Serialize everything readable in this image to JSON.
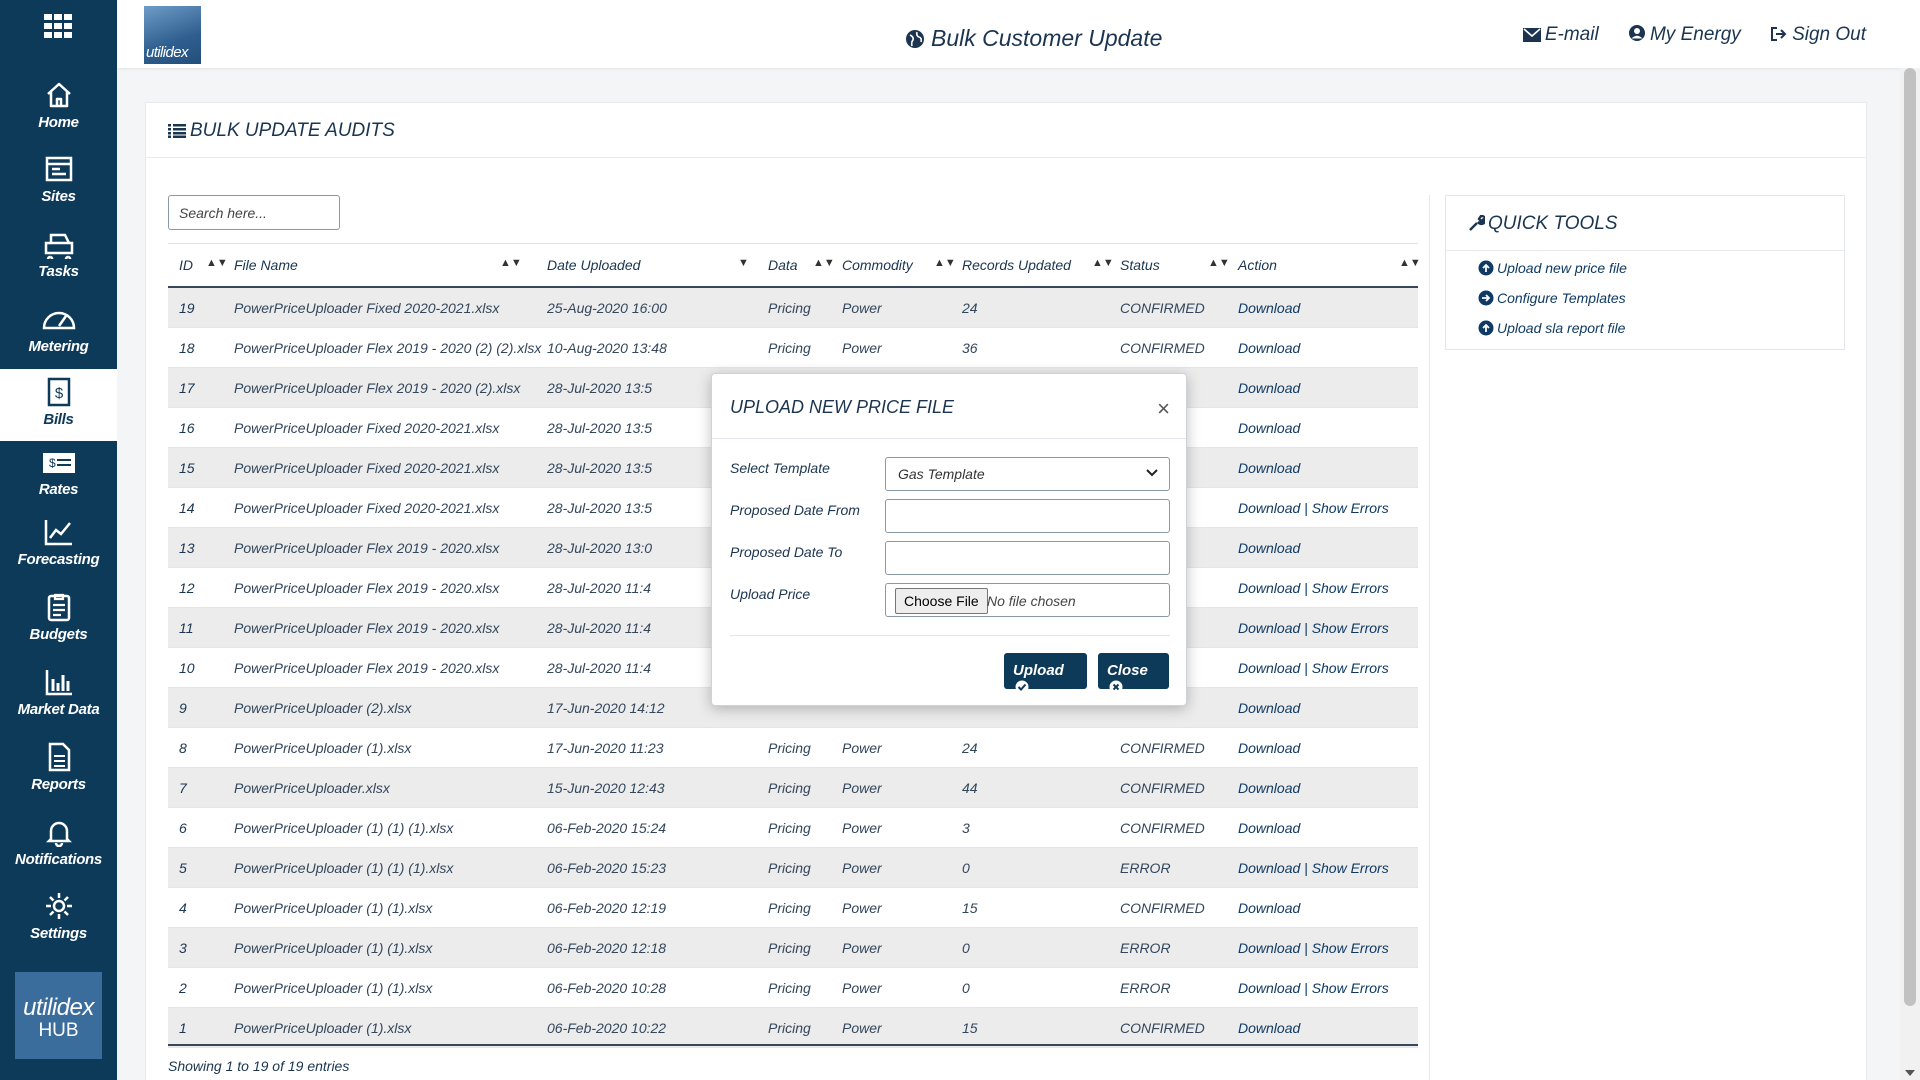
{
  "app": {
    "logo_text": "utilidex",
    "title": "Bulk Customer Update",
    "links": {
      "email": "E-mail",
      "energy": "My Energy",
      "signout": "Sign Out"
    }
  },
  "sidebar": {
    "items": [
      {
        "label": "Home",
        "icon": "home-icon"
      },
      {
        "label": "Sites",
        "icon": "sites-icon"
      },
      {
        "label": "Tasks",
        "icon": "tasks-icon"
      },
      {
        "label": "Metering",
        "icon": "gauge-icon"
      },
      {
        "label": "Bills",
        "icon": "bill-icon",
        "active": true
      },
      {
        "label": "Rates",
        "icon": "rates-icon"
      },
      {
        "label": "Forecasting",
        "icon": "chart-line-icon"
      },
      {
        "label": "Budgets",
        "icon": "clipboard-icon"
      },
      {
        "label": "Market Data",
        "icon": "bar-chart-icon"
      },
      {
        "label": "Reports",
        "icon": "document-icon"
      },
      {
        "label": "Notifications",
        "icon": "bell-icon"
      },
      {
        "label": "Settings",
        "icon": "gear-icon"
      }
    ],
    "hub": {
      "line1": "utilidex",
      "line2": "HUB"
    }
  },
  "audits": {
    "title": "BULK UPDATE AUDITS",
    "search_placeholder": "Search here...",
    "columns": [
      "ID",
      "File Name",
      "Date Uploaded",
      "Data",
      "Commodity",
      "Records Updated",
      "Status",
      "Action"
    ],
    "rows": [
      {
        "id": "19",
        "file": "PowerPriceUploader Fixed 2020-2021.xlsx",
        "date": "25-Aug-2020 16:00",
        "data": "Pricing",
        "commodity": "Power",
        "records": "24",
        "status": "CONFIRMED",
        "show_errors": false
      },
      {
        "id": "18",
        "file": "PowerPriceUploader Flex 2019 - 2020 (2) (2).xlsx",
        "date": "10-Aug-2020 13:48",
        "data": "Pricing",
        "commodity": "Power",
        "records": "36",
        "status": "CONFIRMED",
        "show_errors": false
      },
      {
        "id": "17",
        "file": "PowerPriceUploader Flex 2019 - 2020 (2).xlsx",
        "date": "28-Jul-2020 13:5",
        "data": "",
        "commodity": "",
        "records": "",
        "status": "ED",
        "show_errors": false
      },
      {
        "id": "16",
        "file": "PowerPriceUploader Fixed 2020-2021.xlsx",
        "date": "28-Jul-2020 13:5",
        "data": "",
        "commodity": "",
        "records": "",
        "status": "ED",
        "show_errors": false
      },
      {
        "id": "15",
        "file": "PowerPriceUploader Fixed 2020-2021.xlsx",
        "date": "28-Jul-2020 13:5",
        "data": "",
        "commodity": "",
        "records": "",
        "status": "D",
        "show_errors": false
      },
      {
        "id": "14",
        "file": "PowerPriceUploader Fixed 2020-2021.xlsx",
        "date": "28-Jul-2020 13:5",
        "data": "",
        "commodity": "",
        "records": "",
        "status": "",
        "show_errors": true
      },
      {
        "id": "13",
        "file": "PowerPriceUploader Flex 2019 - 2020.xlsx",
        "date": "28-Jul-2020 13:0",
        "data": "",
        "commodity": "",
        "records": "",
        "status": "ED",
        "show_errors": false
      },
      {
        "id": "12",
        "file": "PowerPriceUploader Flex 2019 - 2020.xlsx",
        "date": "28-Jul-2020 11:4",
        "data": "",
        "commodity": "",
        "records": "",
        "status": "",
        "show_errors": true
      },
      {
        "id": "11",
        "file": "PowerPriceUploader Flex 2019 - 2020.xlsx",
        "date": "28-Jul-2020 11:4",
        "data": "",
        "commodity": "",
        "records": "",
        "status": "",
        "show_errors": true
      },
      {
        "id": "10",
        "file": "PowerPriceUploader Flex 2019 - 2020.xlsx",
        "date": "28-Jul-2020 11:4",
        "data": "",
        "commodity": "",
        "records": "",
        "status": "",
        "show_errors": true
      },
      {
        "id": "9",
        "file": "PowerPriceUploader (2).xlsx",
        "date": "17-Jun-2020 14:12",
        "data": "",
        "commodity": "",
        "records": "",
        "status": "",
        "show_errors": false
      },
      {
        "id": "8",
        "file": "PowerPriceUploader (1).xlsx",
        "date": "17-Jun-2020 11:23",
        "data": "Pricing",
        "commodity": "Power",
        "records": "24",
        "status": "CONFIRMED",
        "show_errors": false
      },
      {
        "id": "7",
        "file": "PowerPriceUploader.xlsx",
        "date": "15-Jun-2020 12:43",
        "data": "Pricing",
        "commodity": "Power",
        "records": "44",
        "status": "CONFIRMED",
        "show_errors": false
      },
      {
        "id": "6",
        "file": "PowerPriceUploader (1) (1) (1).xlsx",
        "date": "06-Feb-2020 15:24",
        "data": "Pricing",
        "commodity": "Power",
        "records": "3",
        "status": "CONFIRMED",
        "show_errors": false
      },
      {
        "id": "5",
        "file": "PowerPriceUploader (1) (1) (1).xlsx",
        "date": "06-Feb-2020 15:23",
        "data": "Pricing",
        "commodity": "Power",
        "records": "0",
        "status": "ERROR",
        "show_errors": true
      },
      {
        "id": "4",
        "file": "PowerPriceUploader (1) (1).xlsx",
        "date": "06-Feb-2020 12:19",
        "data": "Pricing",
        "commodity": "Power",
        "records": "15",
        "status": "CONFIRMED",
        "show_errors": false
      },
      {
        "id": "3",
        "file": "PowerPriceUploader (1) (1).xlsx",
        "date": "06-Feb-2020 12:18",
        "data": "Pricing",
        "commodity": "Power",
        "records": "0",
        "status": "ERROR",
        "show_errors": true
      },
      {
        "id": "2",
        "file": "PowerPriceUploader (1) (1).xlsx",
        "date": "06-Feb-2020 10:28",
        "data": "Pricing",
        "commodity": "Power",
        "records": "0",
        "status": "ERROR",
        "show_errors": true
      },
      {
        "id": "1",
        "file": "PowerPriceUploader (1).xlsx",
        "date": "06-Feb-2020 10:22",
        "data": "Pricing",
        "commodity": "Power",
        "records": "15",
        "status": "CONFIRMED",
        "show_errors": false
      }
    ],
    "download_label": "Download",
    "separator": " | ",
    "show_errors_label": "Show Errors",
    "footer": "Showing 1 to 19 of 19 entries"
  },
  "quick_tools": {
    "title": "QUICK TOOLS",
    "items": [
      "Upload new price file",
      "Configure Templates",
      "Upload sla report file"
    ]
  },
  "modal": {
    "title": "UPLOAD NEW PRICE FILE",
    "close_symbol": "×",
    "labels": {
      "template": "Select Template",
      "date_from": "Proposed Date From",
      "date_to": "Proposed Date To",
      "upload": "Upload Price"
    },
    "template_value": "Gas Template",
    "date_from_value": "",
    "date_to_value": "",
    "choose_file": "Choose File",
    "no_file": "No file chosen",
    "upload_btn": "Upload",
    "close_btn": "Close"
  },
  "colors": {
    "sidebar": "#0e3a5a",
    "accent": "#0e3a5a",
    "row_stripe": "#ececec"
  }
}
